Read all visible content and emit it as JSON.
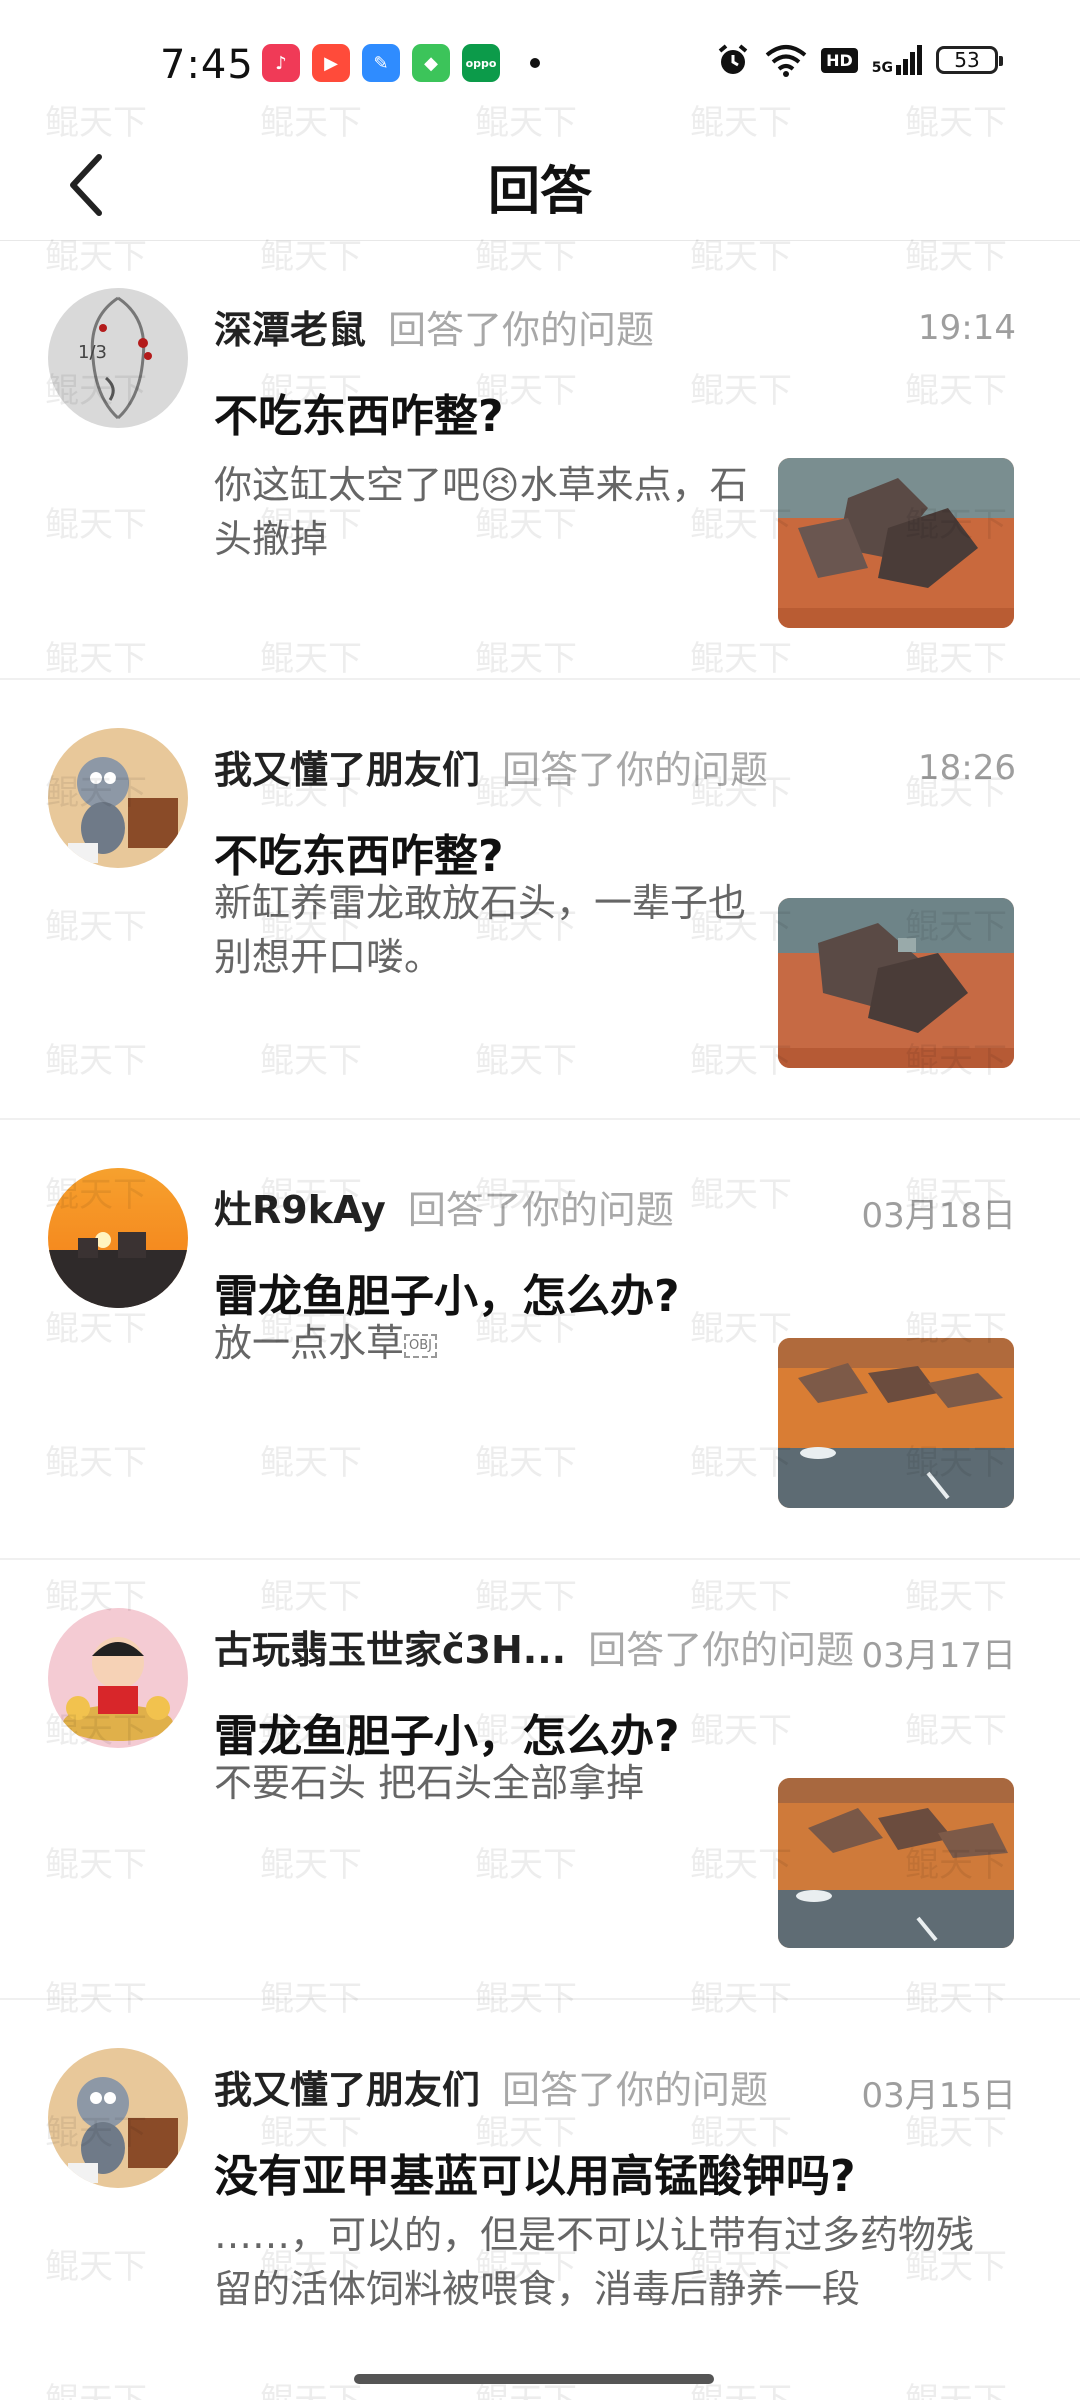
{
  "status_bar": {
    "time": "7:45",
    "network": "5G",
    "hd": "HD",
    "battery": "53",
    "apps": [
      {
        "icon": "music-app-icon",
        "color": "#f03a57"
      },
      {
        "icon": "video-app-icon",
        "color": "#ff4b3a"
      },
      {
        "icon": "feather-app-icon",
        "color": "#2f8cff"
      },
      {
        "icon": "store-app-icon",
        "color": "#3cc45a"
      },
      {
        "icon": "oppo-app-icon",
        "color": "#0c9b4a"
      }
    ]
  },
  "header": {
    "title": "回答"
  },
  "watermark": "鲲天下",
  "items": [
    {
      "username": "深潭老鼠",
      "action": "回答了你的问题",
      "time": "19:14",
      "question": "不吃东西咋整?",
      "answer_before_emoji": "你这缸太空了吧",
      "emoji": "😣",
      "answer_after_emoji": "水草来点，石头撤掉",
      "answer": "",
      "avatar": "face-sketch-avatar",
      "thumb": "rocks-on-sand-thumb"
    },
    {
      "username": "我又懂了朋友们",
      "action": "回答了你的问题",
      "time": "18:26",
      "question": "不吃东西咋整?",
      "answer": "新缸养雷龙敢放石头，一辈子也别想开口喽。",
      "avatar": "cartoon-cat-avatar",
      "thumb": "rocks-on-sand-thumb"
    },
    {
      "username": "灶R9kAy",
      "action": "回答了你的问题",
      "time": "03月18日",
      "question": "雷龙鱼胆子小，怎么办?",
      "answer": "放一点水草",
      "obj_marker": "OBJ",
      "avatar": "sunset-avatar",
      "thumb": "aquarium-sand-thumb"
    },
    {
      "username": "古玩翡玉世家č3H...",
      "action": "回答了你的问题",
      "time": "03月17日",
      "question": "雷龙鱼胆子小，怎么办?",
      "answer": "不要石头 把石头全部拿掉",
      "avatar": "cartoon-boy-gold-avatar",
      "thumb": "aquarium-sand-thumb"
    },
    {
      "username": "我又懂了朋友们",
      "action": "回答了你的问题",
      "time": "03月15日",
      "question": "没有亚甲基蓝可以用高锰酸钾吗?",
      "answer": "……，可以的，但是不可以让带有过多药物残留的活体饲料被喂食，消毒后静养一段",
      "avatar": "cartoon-cat-avatar",
      "thumb": ""
    }
  ]
}
